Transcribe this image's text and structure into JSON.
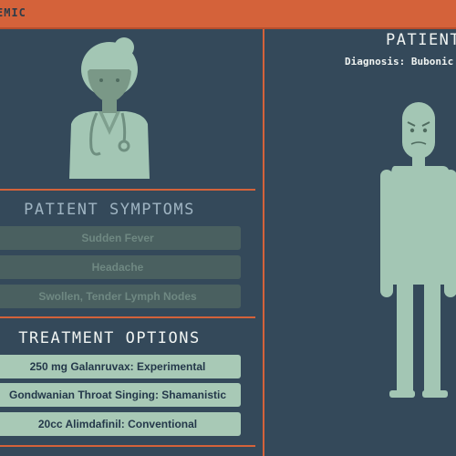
{
  "header": {
    "title": "EMIC"
  },
  "symptoms": {
    "title": "PATIENT SYMPTOMS",
    "items": [
      "Sudden Fever",
      "Headache",
      "Swollen, Tender Lymph Nodes"
    ]
  },
  "treatments": {
    "title": "TREATMENT OPTIONS",
    "items": [
      "250 mg Galanruvax: Experimental",
      "Gondwanian Throat Singing: Shamanistic",
      "20cc Alimdafinil: Conventional"
    ]
  },
  "patient": {
    "title": "PATIENT",
    "diagnosis": "Diagnosis: Bubonic"
  },
  "colors": {
    "background": "#34495a",
    "accent": "#d4623a",
    "figure": "#a3c6b4",
    "symptom_chip": "#4a6060",
    "option_chip": "#a8c9b6"
  },
  "icons": {
    "doctor": "doctor-icon",
    "patient": "patient-figure-icon"
  }
}
